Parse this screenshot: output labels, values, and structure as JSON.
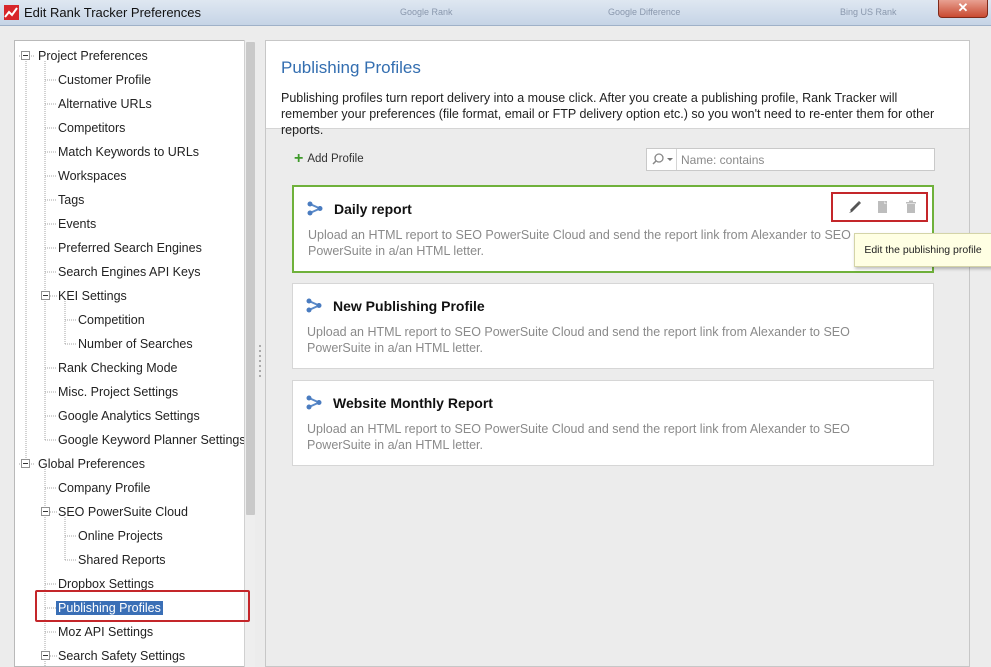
{
  "window": {
    "title": "Edit Rank Tracker Preferences",
    "ghost_tabs": [
      "Google Rank",
      "Google Difference",
      "Bing US Rank"
    ],
    "close_label": "✕"
  },
  "tree": {
    "project_preferences": "Project Preferences",
    "customer_profile": "Customer Profile",
    "alternative_urls": "Alternative URLs",
    "competitors": "Competitors",
    "match_keywords": "Match Keywords to URLs",
    "workspaces": "Workspaces",
    "tags": "Tags",
    "events": "Events",
    "preferred_search_engines": "Preferred Search Engines",
    "search_engines_api_keys": "Search Engines API Keys",
    "kei_settings": "KEI Settings",
    "competition": "Competition",
    "number_of_searches": "Number of Searches",
    "rank_checking_mode": "Rank Checking Mode",
    "misc_project_settings": "Misc. Project Settings",
    "google_analytics_settings": "Google Analytics Settings",
    "google_keyword_planner": "Google Keyword Planner Settings",
    "global_preferences": "Global Preferences",
    "company_profile": "Company Profile",
    "seo_powersuite_cloud": "SEO PowerSuite Cloud",
    "online_projects": "Online Projects",
    "shared_reports": "Shared Reports",
    "dropbox_settings": "Dropbox Settings",
    "publishing_profiles": "Publishing Profiles",
    "moz_api_settings": "Moz API Settings",
    "search_safety_settings": "Search Safety Settings"
  },
  "main": {
    "title": "Publishing Profiles",
    "description": "Publishing profiles turn report delivery into a mouse click. After you create a publishing profile, Rank Tracker will remember your preferences (file format, email or FTP delivery option etc.) so you won't need to re-enter them for other reports.",
    "add_profile_label": "Add Profile",
    "search_placeholder": "Name: contains",
    "profiles": [
      {
        "name": "Daily report",
        "description": "Upload an HTML report to SEO PowerSuite Cloud and send the report link from Alexander  to SEO PowerSuite in a/an HTML letter."
      },
      {
        "name": "New Publishing Profile",
        "description": "Upload an HTML report to SEO PowerSuite Cloud and send the report link from Alexander  to SEO PowerSuite in a/an HTML letter."
      },
      {
        "name": "Website Monthly Report",
        "description": "Upload an HTML report to SEO PowerSuite Cloud and send the report link from Alexander  to SEO PowerSuite in a/an HTML letter."
      }
    ],
    "tooltip": "Edit the publishing profile"
  },
  "colors": {
    "accent_blue": "#336eb0",
    "selection": "#3a6fb6",
    "active_border": "#6fb13b",
    "highlight_red": "#c4262a"
  },
  "icons": [
    "app-icon",
    "plus-icon",
    "search-icon",
    "share-icon",
    "edit-icon",
    "copy-icon",
    "delete-icon"
  ]
}
